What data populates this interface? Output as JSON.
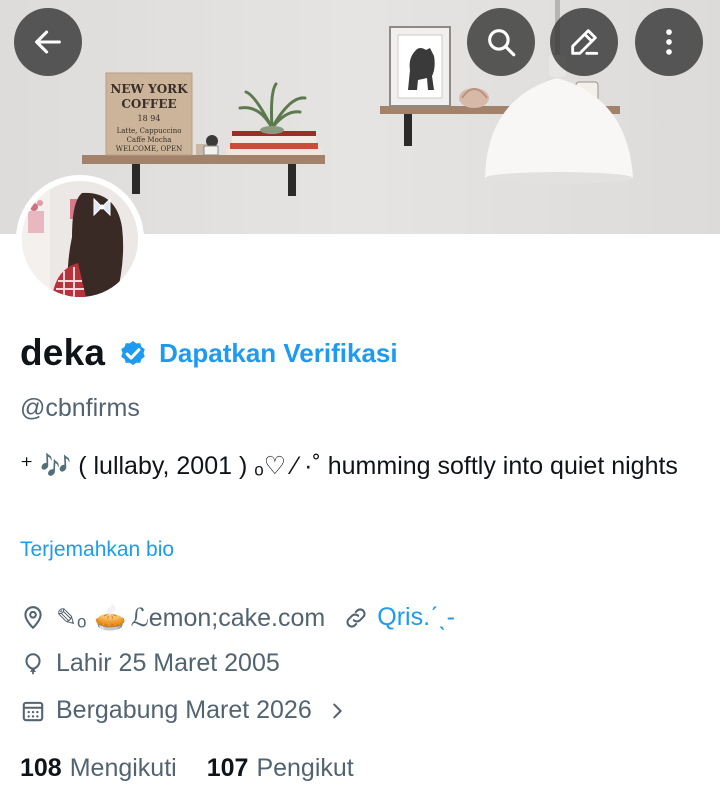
{
  "header": {
    "back_icon": "arrow-left-icon",
    "search_icon": "search-icon",
    "edit_icon": "pencil-icon",
    "more_icon": "more-vertical-icon"
  },
  "banner": {
    "sign_lines": [
      "NEW YORK",
      "COFFEE",
      "18 94",
      "Latte, Cappuccino",
      "Caffe Mocha",
      "WELCOME, OPEN"
    ]
  },
  "profile": {
    "display_name": "deka",
    "verified_icon": "verified-badge-icon",
    "get_verified_label": "Dapatkan Verifikasi",
    "handle": "@cbnfirms",
    "bio": "⁺ 🎶 ( lullaby, 2001 ) ₒ♡ ⁄ ·˚ humming softly into quiet nights",
    "translate_label": "Terjemahkan bio",
    "location_prefix": "✎ₒ",
    "location_emoji": "🥧",
    "location_text": "ℒemon;cake.com",
    "website_text": "Qris.ˊˎ-",
    "birth_text": "Lahir 25 Maret 2005",
    "joined_text": "Bergabung Maret 2026",
    "following_count": "108",
    "following_label": "Mengikuti",
    "followers_count": "107",
    "followers_label": "Pengikut"
  },
  "colors": {
    "accent": "#1d9bf0",
    "text_primary": "#0f1419",
    "text_secondary": "#536471"
  }
}
